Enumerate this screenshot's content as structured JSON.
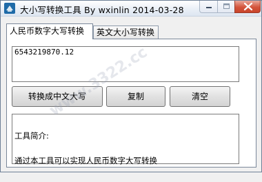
{
  "window": {
    "title": "大小写转换工具  By  wxinlin    2014-03-28",
    "icon": "app-icon"
  },
  "tabs": [
    {
      "label": "人民币数字大写转换",
      "active": true
    },
    {
      "label": "英文大小写转换",
      "active": false
    }
  ],
  "input": {
    "value": "6543219870.12"
  },
  "buttons": {
    "convert": "转换成中文大写",
    "copy": "复制",
    "clear": "清空"
  },
  "intro": {
    "heading": "工具简介:",
    "text": "通过本工具可以实现人民币数字大写转换"
  },
  "watermark": {
    "text": "www.3322.cc"
  },
  "colors": {
    "close_button": "#d4543c",
    "title_bar": "#e8eef6",
    "icon_blue": "#1f6ba8"
  }
}
